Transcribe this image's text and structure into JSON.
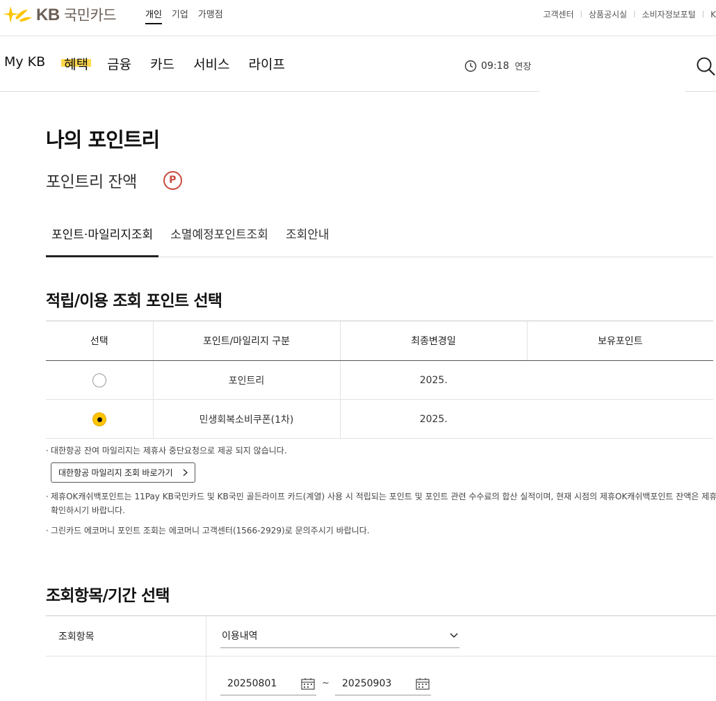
{
  "header": {
    "brand": {
      "latin": "KB",
      "korean": "국민카드"
    },
    "segments": [
      {
        "label": "개인",
        "active": true
      },
      {
        "label": "기업",
        "active": false
      },
      {
        "label": "가맹점",
        "active": false
      }
    ],
    "utility_links": [
      "고객센터",
      "상품공시실",
      "소비자정보포털",
      "K"
    ]
  },
  "gnb": {
    "menu": [
      {
        "label": "My KB",
        "active": false
      },
      {
        "label": "혜택",
        "active": true
      },
      {
        "label": "금융",
        "active": false
      },
      {
        "label": "카드",
        "active": false
      },
      {
        "label": "서비스",
        "active": false
      },
      {
        "label": "라이프",
        "active": false
      }
    ],
    "session_time": "09:18",
    "extend_label": "연장",
    "icons": {
      "session": "clock-icon",
      "search": "search-icon"
    }
  },
  "page": {
    "title": "나의 포인트리",
    "balance_label": "포인트리 잔액",
    "balance_badge": "P",
    "tabs": [
      {
        "label": "포인트·마일리지조회",
        "active": true
      },
      {
        "label": "소멸예정포인트조회",
        "active": false
      },
      {
        "label": "조회안내",
        "active": false
      }
    ]
  },
  "point_select": {
    "section_title": "적립/이용 조회 포인트 선택",
    "columns": [
      "선택",
      "포인트/마일리지 구분",
      "최종변경일",
      "보유포인트"
    ],
    "rows": [
      {
        "selected": false,
        "name": "포인트리",
        "last_changed": "2025."
      },
      {
        "selected": true,
        "name": "민생회복소비쿠폰(1차)",
        "last_changed": "2025."
      }
    ],
    "notes": {
      "korean_air": "대한항공 잔여 마일리지는 제휴사 중단요청으로 제공 되지 않습니다.",
      "korean_air_button": "대한항공 마일리지 조회 바로가기",
      "ok_cashbag_line1": "제휴OK캐쉬백포인트는 11Pay KB국민카드 및 KB국민 골든라이프 카드(계열) 사용 시 적립되는 포인트 및 포인트 관련 수수료의 합산 실적이며, 현재 시점의 제휴OK캐쉬백포인트 잔액은 제휴사를 통해",
      "ok_cashbag_line2": "확인하시기 바랍니다.",
      "green_card": "그린카드 에코머니 포인트 조회는 에코머니 고객센터(1566-2929)로 문의주시기 바랍니다."
    }
  },
  "search_form": {
    "section_title": "조회항목/기간 선택",
    "item_label": "조회항목",
    "item_value": "이용내역",
    "period_label": "",
    "date_from": "20250801",
    "date_to": "20250903",
    "range_separator": "~"
  },
  "colors": {
    "brand_yellow": "#ffc400",
    "highlight": "#ffd84d",
    "badge_red": "#c94a3c",
    "logo_gray": "#6b5f55"
  }
}
